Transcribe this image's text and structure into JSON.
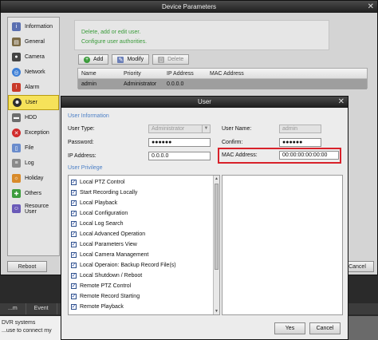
{
  "main_window": {
    "title": "Device Parameters",
    "close": "✕",
    "info_lines": [
      "Delete, add or edit user.",
      "Configure user authorities."
    ],
    "toolbar": {
      "add": "Add",
      "modify": "Modify",
      "delete": "Delete"
    },
    "table": {
      "headers": [
        "Name",
        "Priority",
        "IP Address",
        "MAC Address"
      ],
      "rows": [
        {
          "name": "admin",
          "priority": "Administrator",
          "ip": "0.0.0.0",
          "mac": ""
        }
      ]
    },
    "reboot": "Reboot",
    "cancel": "Cancel"
  },
  "sidebar": {
    "items": [
      {
        "label": "Information",
        "icon": "info-icon",
        "color": "#5a6fb0"
      },
      {
        "label": "General",
        "icon": "general-icon",
        "color": "#7b6a45"
      },
      {
        "label": "Camera",
        "icon": "camera-icon",
        "color": "#444444"
      },
      {
        "label": "Network",
        "icon": "network-icon",
        "color": "#3d7fd6"
      },
      {
        "label": "Alarm",
        "icon": "alarm-icon",
        "color": "#c93a2a"
      },
      {
        "label": "User",
        "icon": "user-icon",
        "color": "#2d2d2d"
      },
      {
        "label": "HDD",
        "icon": "hdd-icon",
        "color": "#6d6d6d"
      },
      {
        "label": "Exception",
        "icon": "exception-icon",
        "color": "#d12b2b"
      },
      {
        "label": "File",
        "icon": "file-icon",
        "color": "#6a8ccc"
      },
      {
        "label": "Log",
        "icon": "log-icon",
        "color": "#8a8a8a"
      },
      {
        "label": "Holiday",
        "icon": "holiday-icon",
        "color": "#d88a2a"
      },
      {
        "label": "Others",
        "icon": "others-icon",
        "color": "#3d9c3d"
      },
      {
        "label": "Resource User",
        "icon": "resource-user-icon",
        "color": "#6a5ab8"
      }
    ],
    "active_index": 5
  },
  "bottom": {
    "tabs": [
      "...m",
      "Event"
    ],
    "text_lines": [
      "DVR systems",
      "...use to connect my"
    ]
  },
  "user_dialog": {
    "title": "User",
    "close": "✕",
    "section_info": "User Information",
    "user_type_label": "User Type:",
    "user_type_value": "Administrator",
    "password_label": "Password:",
    "password_value": "●●●●●●",
    "ip_label": "IP Address:",
    "ip_value": "0.0.0.0",
    "username_label": "User Name:",
    "username_value": "admin",
    "confirm_label": "Confirm:",
    "confirm_value": "●●●●●●",
    "mac_label": "MAC Address:",
    "mac_value": "00:00:00:00:00:00",
    "section_priv": "User Privilege",
    "privileges": [
      "Local PTZ Control",
      "Start Recording Locally",
      "Local Playback",
      "Local Configuration",
      "Local Log Search",
      "Local Advanced Operation",
      "Local Parameters View",
      "Local Camera Management",
      "Local Operaion: Backup Record File(s)",
      "Local Shutdown / Reboot",
      "Remote PTZ Control",
      "Remote Record Starting",
      "Remote Playback"
    ],
    "yes": "Yes",
    "cancel": "Cancel",
    "highlight_color": "#d8212a"
  }
}
